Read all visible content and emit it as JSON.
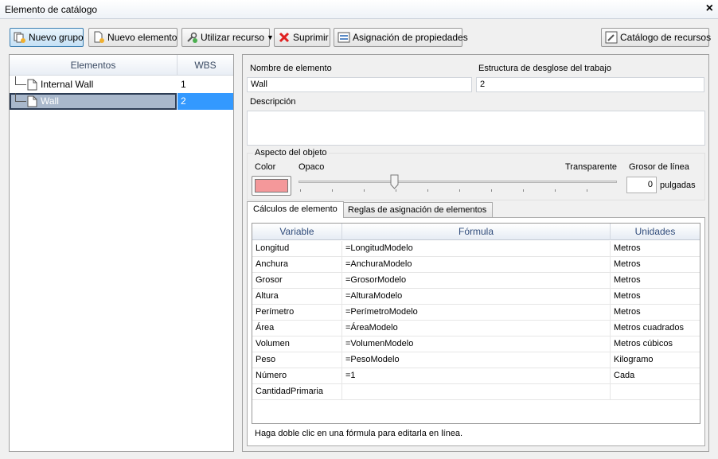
{
  "window": {
    "title": "Elemento de catálogo",
    "close_label": "×"
  },
  "toolbar": {
    "new_group": "Nuevo grupo",
    "new_element": "Nuevo elemento",
    "use_resource": "Utilizar recurso",
    "delete": "Suprimir",
    "property_mapping": "Asignación de propiedades",
    "resource_catalog": "Catálogo de recursos"
  },
  "tree": {
    "header_elements": "Elementos",
    "header_wbs": "WBS",
    "rows": [
      {
        "name": "Internal Wall",
        "wbs": "1",
        "selected": false
      },
      {
        "name": "Wall",
        "wbs": "2",
        "selected": true
      }
    ]
  },
  "details": {
    "name_label": "Nombre de elemento",
    "name_value": "Wall",
    "wbs_label": "Estructura de desglose del trabajo",
    "wbs_value": "2",
    "description_label": "Descripción",
    "description_value": ""
  },
  "appearance": {
    "group_label": "Aspecto del objeto",
    "color_label": "Color",
    "color_value": "#f4989a",
    "opaque_label": "Opaco",
    "transparent_label": "Transparente",
    "transparency": 0.3,
    "line_thickness_label": "Grosor de línea",
    "line_thickness_value": "0",
    "line_thickness_unit": "pulgadas"
  },
  "tabs": [
    {
      "label": "Cálculos de elemento",
      "active": true
    },
    {
      "label": "Reglas de asignación de elementos",
      "active": false
    }
  ],
  "grid": {
    "headers": {
      "variable": "Variable",
      "formula": "Fórmula",
      "units": "Unidades"
    },
    "rows": [
      {
        "variable": "Longitud",
        "formula": "=LongitudModelo",
        "units": "Metros"
      },
      {
        "variable": "Anchura",
        "formula": "=AnchuraModelo",
        "units": "Metros"
      },
      {
        "variable": "Grosor",
        "formula": "=GrosorModelo",
        "units": "Metros"
      },
      {
        "variable": "Altura",
        "formula": "=AlturaModelo",
        "units": "Metros"
      },
      {
        "variable": "Perímetro",
        "formula": "=PerímetroModelo",
        "units": "Metros"
      },
      {
        "variable": "Área",
        "formula": "=ÁreaModelo",
        "units": "Metros cuadrados"
      },
      {
        "variable": "Volumen",
        "formula": "=VolumenModelo",
        "units": "Metros cúbicos"
      },
      {
        "variable": "Peso",
        "formula": "=PesoModelo",
        "units": "Kilogramo"
      },
      {
        "variable": "Número",
        "formula": "=1",
        "units": "Cada"
      },
      {
        "variable": "CantidadPrimaria",
        "formula": "",
        "units": ""
      }
    ]
  },
  "hint": "Haga doble clic en una fórmula para editarla en línea."
}
